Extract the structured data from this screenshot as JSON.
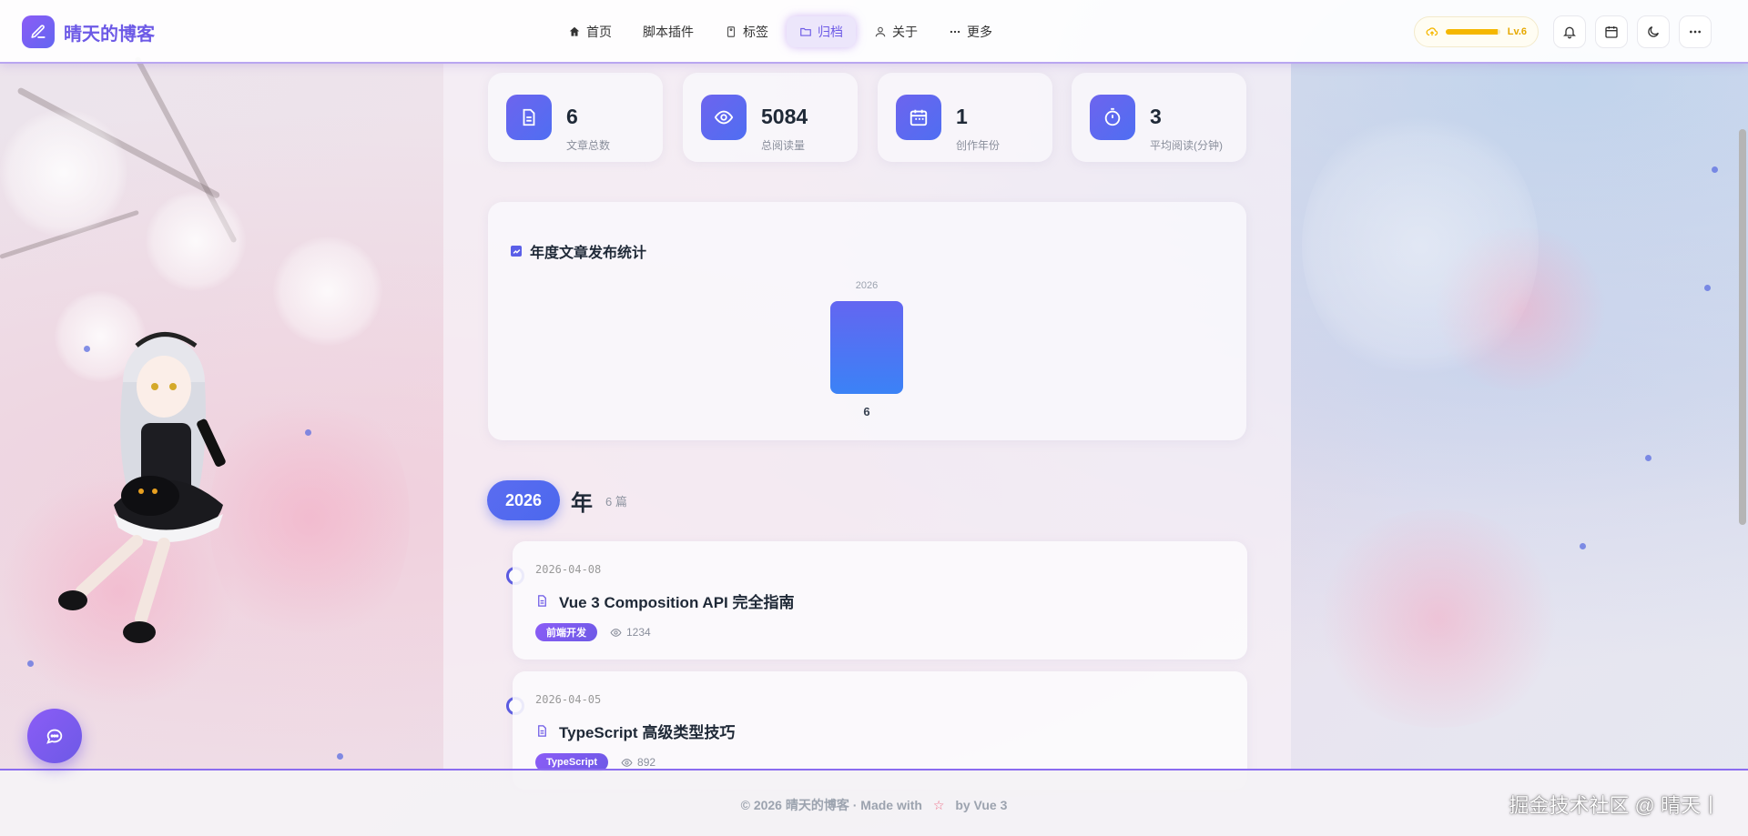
{
  "app": {
    "logo_text": "晴天的博客"
  },
  "nav": {
    "items": [
      {
        "label": "首页",
        "icon": "home-icon",
        "active": false
      },
      {
        "label": "脚本插件",
        "icon": "",
        "active": false
      },
      {
        "label": "标签",
        "icon": "tag-icon",
        "active": false
      },
      {
        "label": "归档",
        "icon": "folder-icon",
        "active": true
      },
      {
        "label": "关于",
        "icon": "user-icon",
        "active": false
      },
      {
        "label": "更多",
        "icon": "more-dots-icon",
        "active": false
      }
    ]
  },
  "toolbar": {
    "level_label": "Lv.6",
    "level_progress": 0.95,
    "level_color": "#f5b700",
    "tools": [
      "bell-icon",
      "calendar-icon",
      "moon-icon",
      "more-horizontal-icon"
    ]
  },
  "stats": [
    {
      "value": "6",
      "label": "文章总数",
      "icon": "document-icon"
    },
    {
      "value": "5084",
      "label": "总阅读量",
      "icon": "eye-icon"
    },
    {
      "value": "1",
      "label": "创作年份",
      "icon": "calendar-icon"
    },
    {
      "value": "3",
      "label": "平均阅读(分钟)",
      "icon": "timer-icon"
    }
  ],
  "chart_data": {
    "type": "bar",
    "title": "年度文章发布统计",
    "categories": [
      "2026"
    ],
    "values": [
      6
    ],
    "ylim": [
      0,
      6
    ],
    "bar_gradient": [
      "#6366f1",
      "#3b82f6"
    ],
    "grid": false
  },
  "archive": {
    "year": "2026",
    "year_suffix": "年",
    "count_text": "6 篇",
    "posts": [
      {
        "date": "2026-04-08",
        "title": "Vue 3 Composition API 完全指南",
        "tag": "前端开发",
        "views": "1234"
      },
      {
        "date": "2026-04-05",
        "title": "TypeScript 高级类型技巧",
        "tag": "TypeScript",
        "views": "892"
      }
    ]
  },
  "footer": {
    "prefix": "© 2026 晴天的博客 · Made with",
    "suffix": "by Vue 3",
    "watermark": "掘金技术社区 @ 晴天丨"
  },
  "colors": {
    "accent": "#6d5ae6",
    "primary_blue": "#4f6ef2",
    "timeline_dot": "#5656e0"
  }
}
